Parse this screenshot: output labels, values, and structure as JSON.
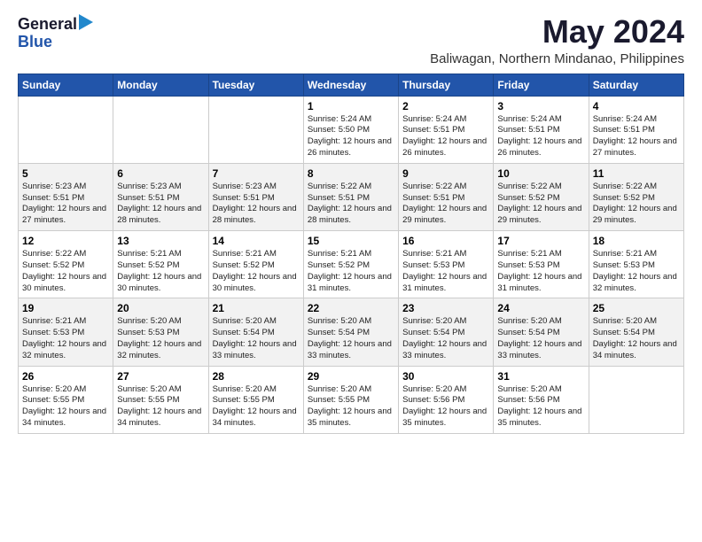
{
  "logo": {
    "general": "General",
    "blue": "Blue"
  },
  "title": {
    "month_year": "May 2024",
    "location": "Baliwagan, Northern Mindanao, Philippines"
  },
  "weekdays": [
    "Sunday",
    "Monday",
    "Tuesday",
    "Wednesday",
    "Thursday",
    "Friday",
    "Saturday"
  ],
  "rows": [
    [
      {
        "day": "",
        "sunrise": "",
        "sunset": "",
        "daylight": ""
      },
      {
        "day": "",
        "sunrise": "",
        "sunset": "",
        "daylight": ""
      },
      {
        "day": "",
        "sunrise": "",
        "sunset": "",
        "daylight": ""
      },
      {
        "day": "1",
        "sunrise": "Sunrise: 5:24 AM",
        "sunset": "Sunset: 5:50 PM",
        "daylight": "Daylight: 12 hours and 26 minutes."
      },
      {
        "day": "2",
        "sunrise": "Sunrise: 5:24 AM",
        "sunset": "Sunset: 5:51 PM",
        "daylight": "Daylight: 12 hours and 26 minutes."
      },
      {
        "day": "3",
        "sunrise": "Sunrise: 5:24 AM",
        "sunset": "Sunset: 5:51 PM",
        "daylight": "Daylight: 12 hours and 26 minutes."
      },
      {
        "day": "4",
        "sunrise": "Sunrise: 5:24 AM",
        "sunset": "Sunset: 5:51 PM",
        "daylight": "Daylight: 12 hours and 27 minutes."
      }
    ],
    [
      {
        "day": "5",
        "sunrise": "Sunrise: 5:23 AM",
        "sunset": "Sunset: 5:51 PM",
        "daylight": "Daylight: 12 hours and 27 minutes."
      },
      {
        "day": "6",
        "sunrise": "Sunrise: 5:23 AM",
        "sunset": "Sunset: 5:51 PM",
        "daylight": "Daylight: 12 hours and 28 minutes."
      },
      {
        "day": "7",
        "sunrise": "Sunrise: 5:23 AM",
        "sunset": "Sunset: 5:51 PM",
        "daylight": "Daylight: 12 hours and 28 minutes."
      },
      {
        "day": "8",
        "sunrise": "Sunrise: 5:22 AM",
        "sunset": "Sunset: 5:51 PM",
        "daylight": "Daylight: 12 hours and 28 minutes."
      },
      {
        "day": "9",
        "sunrise": "Sunrise: 5:22 AM",
        "sunset": "Sunset: 5:51 PM",
        "daylight": "Daylight: 12 hours and 29 minutes."
      },
      {
        "day": "10",
        "sunrise": "Sunrise: 5:22 AM",
        "sunset": "Sunset: 5:52 PM",
        "daylight": "Daylight: 12 hours and 29 minutes."
      },
      {
        "day": "11",
        "sunrise": "Sunrise: 5:22 AM",
        "sunset": "Sunset: 5:52 PM",
        "daylight": "Daylight: 12 hours and 29 minutes."
      }
    ],
    [
      {
        "day": "12",
        "sunrise": "Sunrise: 5:22 AM",
        "sunset": "Sunset: 5:52 PM",
        "daylight": "Daylight: 12 hours and 30 minutes."
      },
      {
        "day": "13",
        "sunrise": "Sunrise: 5:21 AM",
        "sunset": "Sunset: 5:52 PM",
        "daylight": "Daylight: 12 hours and 30 minutes."
      },
      {
        "day": "14",
        "sunrise": "Sunrise: 5:21 AM",
        "sunset": "Sunset: 5:52 PM",
        "daylight": "Daylight: 12 hours and 30 minutes."
      },
      {
        "day": "15",
        "sunrise": "Sunrise: 5:21 AM",
        "sunset": "Sunset: 5:52 PM",
        "daylight": "Daylight: 12 hours and 31 minutes."
      },
      {
        "day": "16",
        "sunrise": "Sunrise: 5:21 AM",
        "sunset": "Sunset: 5:53 PM",
        "daylight": "Daylight: 12 hours and 31 minutes."
      },
      {
        "day": "17",
        "sunrise": "Sunrise: 5:21 AM",
        "sunset": "Sunset: 5:53 PM",
        "daylight": "Daylight: 12 hours and 31 minutes."
      },
      {
        "day": "18",
        "sunrise": "Sunrise: 5:21 AM",
        "sunset": "Sunset: 5:53 PM",
        "daylight": "Daylight: 12 hours and 32 minutes."
      }
    ],
    [
      {
        "day": "19",
        "sunrise": "Sunrise: 5:21 AM",
        "sunset": "Sunset: 5:53 PM",
        "daylight": "Daylight: 12 hours and 32 minutes."
      },
      {
        "day": "20",
        "sunrise": "Sunrise: 5:20 AM",
        "sunset": "Sunset: 5:53 PM",
        "daylight": "Daylight: 12 hours and 32 minutes."
      },
      {
        "day": "21",
        "sunrise": "Sunrise: 5:20 AM",
        "sunset": "Sunset: 5:54 PM",
        "daylight": "Daylight: 12 hours and 33 minutes."
      },
      {
        "day": "22",
        "sunrise": "Sunrise: 5:20 AM",
        "sunset": "Sunset: 5:54 PM",
        "daylight": "Daylight: 12 hours and 33 minutes."
      },
      {
        "day": "23",
        "sunrise": "Sunrise: 5:20 AM",
        "sunset": "Sunset: 5:54 PM",
        "daylight": "Daylight: 12 hours and 33 minutes."
      },
      {
        "day": "24",
        "sunrise": "Sunrise: 5:20 AM",
        "sunset": "Sunset: 5:54 PM",
        "daylight": "Daylight: 12 hours and 33 minutes."
      },
      {
        "day": "25",
        "sunrise": "Sunrise: 5:20 AM",
        "sunset": "Sunset: 5:54 PM",
        "daylight": "Daylight: 12 hours and 34 minutes."
      }
    ],
    [
      {
        "day": "26",
        "sunrise": "Sunrise: 5:20 AM",
        "sunset": "Sunset: 5:55 PM",
        "daylight": "Daylight: 12 hours and 34 minutes."
      },
      {
        "day": "27",
        "sunrise": "Sunrise: 5:20 AM",
        "sunset": "Sunset: 5:55 PM",
        "daylight": "Daylight: 12 hours and 34 minutes."
      },
      {
        "day": "28",
        "sunrise": "Sunrise: 5:20 AM",
        "sunset": "Sunset: 5:55 PM",
        "daylight": "Daylight: 12 hours and 34 minutes."
      },
      {
        "day": "29",
        "sunrise": "Sunrise: 5:20 AM",
        "sunset": "Sunset: 5:55 PM",
        "daylight": "Daylight: 12 hours and 35 minutes."
      },
      {
        "day": "30",
        "sunrise": "Sunrise: 5:20 AM",
        "sunset": "Sunset: 5:56 PM",
        "daylight": "Daylight: 12 hours and 35 minutes."
      },
      {
        "day": "31",
        "sunrise": "Sunrise: 5:20 AM",
        "sunset": "Sunset: 5:56 PM",
        "daylight": "Daylight: 12 hours and 35 minutes."
      },
      {
        "day": "",
        "sunrise": "",
        "sunset": "",
        "daylight": ""
      }
    ]
  ]
}
